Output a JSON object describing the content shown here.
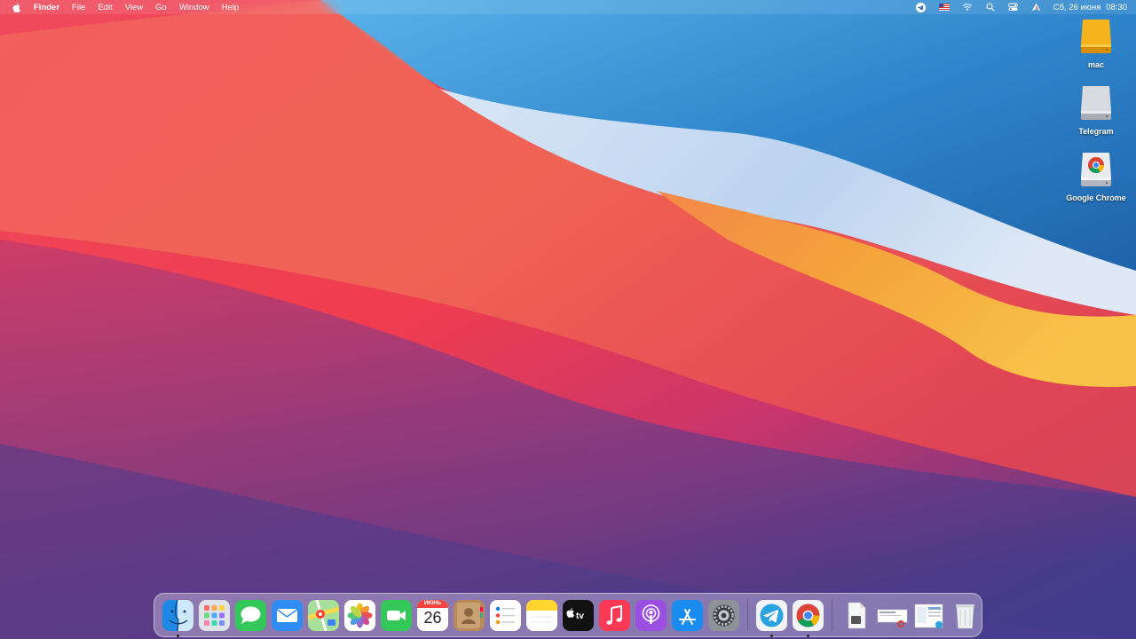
{
  "menubar": {
    "app_name": "Finder",
    "menus": [
      "File",
      "Edit",
      "View",
      "Go",
      "Window",
      "Help"
    ],
    "status_icons": [
      "telegram-icon",
      "us-flag-icon",
      "wifi-icon",
      "search-icon",
      "control-center-icon",
      "vpn-icon"
    ],
    "date": "Сб, 26 июня",
    "time": "08:30"
  },
  "desktop": {
    "icons": [
      {
        "label": "mac",
        "icon": "hard-drive-icon",
        "color": "#f0a70f"
      },
      {
        "label": "Telegram",
        "icon": "disk-image-icon",
        "color": "#c8ccd2"
      },
      {
        "label": "Google Chrome",
        "icon": "chrome-disk-icon",
        "color": "#e2e4e8"
      }
    ]
  },
  "dock": {
    "calendar": {
      "month": "ИЮНЬ",
      "day": "26"
    },
    "apps": [
      "Finder",
      "Launchpad",
      "Messages",
      "Mail",
      "Maps",
      "Photos",
      "FaceTime",
      "Calendar",
      "Contacts",
      "Reminders",
      "Notes",
      "Apple TV",
      "Music",
      "Podcasts",
      "App Store",
      "System Preferences"
    ],
    "running": [
      "Telegram",
      "Google Chrome"
    ],
    "stacks": [
      "Document",
      "Downloads-stack",
      "Screenshots-stack",
      "Trash"
    ],
    "active_indicators": [
      "Finder",
      "Telegram",
      "Google Chrome"
    ]
  },
  "colors": {
    "wallpaper_red": "#e83550",
    "wallpaper_orange": "#f3a43a",
    "wallpaper_blue": "#2e82c8",
    "wallpaper_purple": "#6a3f8f"
  }
}
